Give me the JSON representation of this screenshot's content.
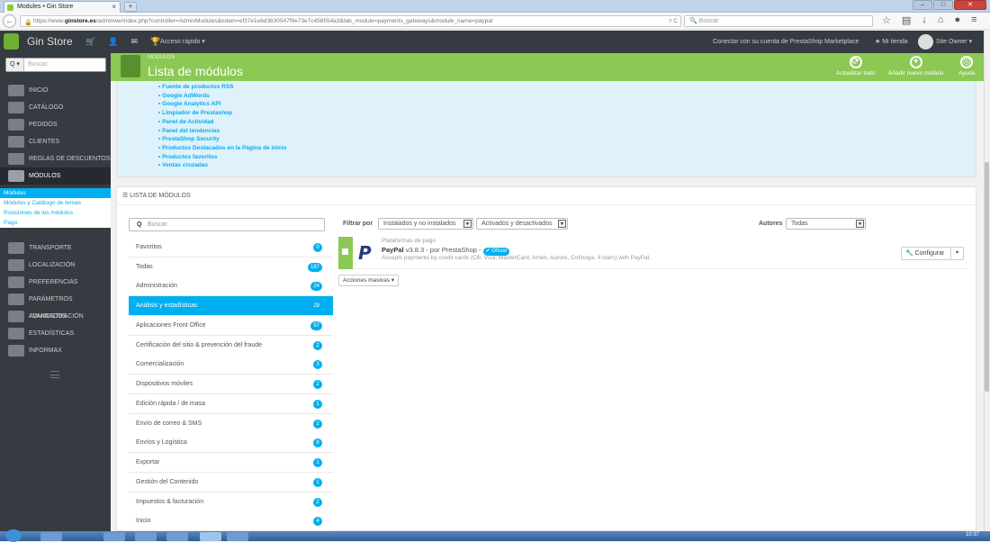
{
  "browser": {
    "tab_title": "Modules • Gin Store",
    "tab_close": "×",
    "new_tab": "+",
    "url_prefix": "https://www.",
    "url_domain": "ginstore.es",
    "url_rest": "/adminwe/index.php?controller=AdminModules&token=ef37e1e6d3630547f9e73e7c458554a3&tab_module=payments_gateways&module_name=paypal",
    "url_reload": "▿ C",
    "search_placeholder": "Buscar"
  },
  "topbar": {
    "store_name": "Gin Store",
    "quick_access": "Acceso rápido ▾",
    "marketplace": "Conectar con su cuenta de PrestaShop Marketplace",
    "my_store": "★ Mi tienda",
    "owner": "Site Owner ▾"
  },
  "sidebar": {
    "search_placeholder": "Buscar",
    "search_toggle": "Q ▾",
    "items": [
      {
        "label": "INICIO"
      },
      {
        "label": "CATÁLOGO"
      },
      {
        "label": "PEDIDOS"
      },
      {
        "label": "CLIENTES"
      },
      {
        "label": "REGLAS DE DESCUENTOS"
      },
      {
        "label": "MÓDULOS"
      },
      {
        "label": "TRANSPORTE"
      },
      {
        "label": "LOCALIZACIÓN"
      },
      {
        "label": "PREFERENCIAS"
      },
      {
        "label": "PARÁMETROS AVANZADOS"
      },
      {
        "label": "ADMINISTRACIÓN"
      },
      {
        "label": "ESTADÍSTICAS"
      },
      {
        "label": "INFORMAX"
      }
    ],
    "subitems": [
      {
        "label": "Módulos"
      },
      {
        "label": "Módulos y Catálogo de temas"
      },
      {
        "label": "Posiciones de los módulos"
      },
      {
        "label": "Pago"
      }
    ]
  },
  "header": {
    "breadcrumb": "Módulos",
    "title": "Lista de módulos",
    "toolbar": [
      {
        "label": "Actualizar todo",
        "icon": "refresh-icon",
        "glyph": "⟳"
      },
      {
        "label": "Añadir nuevo módulo",
        "icon": "plus-icon",
        "glyph": "+"
      },
      {
        "label": "Ayuda",
        "icon": "help-icon",
        "glyph": "◎"
      }
    ]
  },
  "recommended": [
    "Fuente de productos RSS",
    "Google AdWords",
    "Google Analytics API",
    "Limpiador de Prestashop",
    "Panel de Actividad",
    "Panel del tendencias",
    "PrestaShop Security",
    "Productos Destacados en la Página de inicio",
    "Productos favoritos",
    "Ventas cruzadas"
  ],
  "module_list": {
    "heading": "☰ LISTA DE MÓDULOS",
    "search_placeholder": "Buscar",
    "categories": [
      {
        "label": "Favoritos",
        "count": "0"
      },
      {
        "label": "Todas",
        "count": "187"
      },
      {
        "label": "Administración",
        "count": "24"
      },
      {
        "label": "Análisis y estadísticas",
        "count": "29"
      },
      {
        "label": "Aplicaciones Front Office",
        "count": "57"
      },
      {
        "label": "Certificación del sitio & prevención del fraude",
        "count": "2"
      },
      {
        "label": "Comercialización",
        "count": "3"
      },
      {
        "label": "Dispositivos móviles",
        "count": "2"
      },
      {
        "label": "Edición rápida / de masa",
        "count": "1"
      },
      {
        "label": "Envío de correo & SMS",
        "count": "2"
      },
      {
        "label": "Envíos y Logística",
        "count": "8"
      },
      {
        "label": "Exportar",
        "count": "1"
      },
      {
        "label": "Gestión del Contenido",
        "count": "1"
      },
      {
        "label": "Impuestos & facturación",
        "count": "2"
      },
      {
        "label": "Inicio",
        "count": "4"
      }
    ],
    "filter_label": "Filtrar por",
    "filter_install": "Instalados y no instalados",
    "filter_active": "Activados y desactivados",
    "authors_label": "Autores",
    "authors_value": "Todas",
    "module": {
      "category": "Plataformas de pago",
      "name": "PayPal",
      "meta": "v3.8.3 - por PrestaShop -",
      "official": "Oficial",
      "description": "Accepts payments by credit cards (CB, Visa, MasterCard, Amex, Aurore, Cofinoga, 4 stars) with PayPal.",
      "configure": "Configurar"
    },
    "bulk_actions": "Acciones masivas ▾"
  },
  "taskbar": {
    "time": "10:37"
  },
  "colors": {
    "accent": "#00aff0",
    "green": "#8bc954",
    "dark": "#363a41"
  }
}
